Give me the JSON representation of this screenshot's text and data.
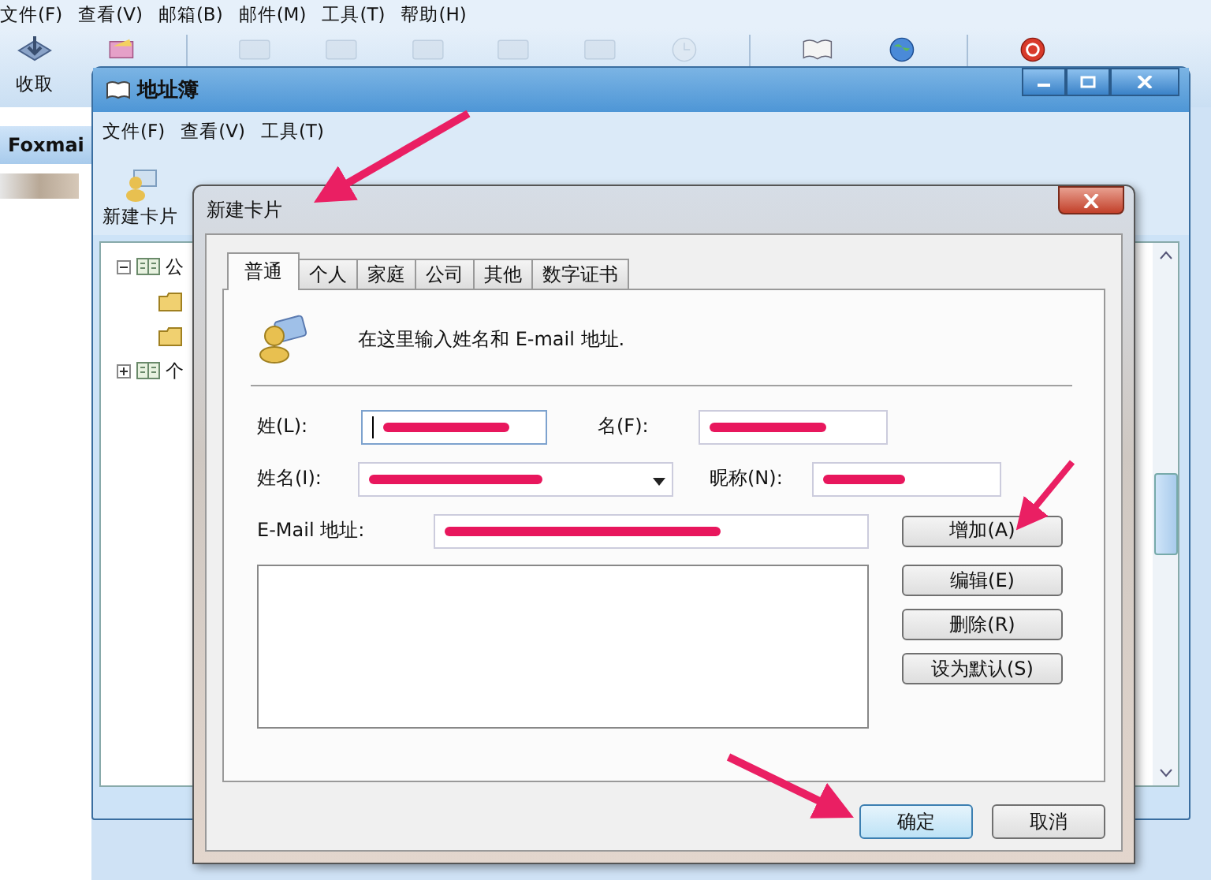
{
  "main_window": {
    "menu": [
      "文件(F)",
      "查看(V)",
      "邮箱(B)",
      "邮件(M)",
      "工具(T)",
      "帮助(H)"
    ],
    "toolbar": [
      {
        "label": "收取"
      }
    ],
    "sidebar_title": "Foxmai"
  },
  "address_book": {
    "title": "地址簿",
    "menu": [
      "文件(F)",
      "查看(V)",
      "工具(T)"
    ],
    "toolbar": [
      {
        "label": "新建卡片"
      }
    ],
    "tree": [
      {
        "label": "公",
        "kind": "book",
        "expanded": true,
        "children": [
          {
            "kind": "folder"
          },
          {
            "kind": "folder"
          }
        ]
      },
      {
        "label": "个",
        "kind": "book",
        "expanded": false
      }
    ]
  },
  "dialog": {
    "title": "新建卡片",
    "tabs": [
      {
        "label": "普通",
        "selected": true
      },
      {
        "label": "个人",
        "selected": false
      },
      {
        "label": "家庭",
        "selected": false
      },
      {
        "label": "公司",
        "selected": false
      },
      {
        "label": "其他",
        "selected": false
      },
      {
        "label": "数字证书",
        "selected": false
      }
    ],
    "intro": "在这里输入姓名和 E-mail 地址.",
    "rows": [
      [
        {
          "label": "姓(L):",
          "kind": "text",
          "focused": true,
          "redacted": true
        },
        {
          "label": "名(F):",
          "kind": "text",
          "focused": false,
          "redacted": true
        }
      ],
      [
        {
          "label": "姓名(I):",
          "kind": "combo",
          "focused": false,
          "redacted": true
        },
        {
          "label": "昵称(N):",
          "kind": "text",
          "focused": false,
          "redacted": true
        }
      ],
      [
        {
          "label": "E-Mail 地址:",
          "kind": "text",
          "focused": false,
          "redacted": true
        }
      ]
    ],
    "add_button": "增加(A)",
    "list_buttons": [
      "编辑(E)",
      "删除(R)",
      "设为默认(S)"
    ],
    "buttons": [
      {
        "label": "确定",
        "default": true
      },
      {
        "label": "取消",
        "default": false
      }
    ]
  }
}
